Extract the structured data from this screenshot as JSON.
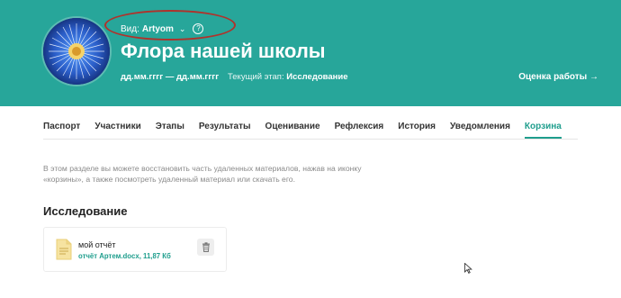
{
  "header": {
    "view_label": "Вид:",
    "view_value": "Artyom",
    "view_chevron": "⌄",
    "help_glyph": "?",
    "project_title": "Флора нашей школы",
    "dates": "дд.мм.гггг — дд.мм.гггг",
    "stage_label": "Текущий этап:",
    "stage_value": "Исследование",
    "assess_link": "Оценка работы →",
    "avatar_icon": "dandelion-avatar"
  },
  "tabs": [
    {
      "label": "Паспорт"
    },
    {
      "label": "Участники"
    },
    {
      "label": "Этапы"
    },
    {
      "label": "Результаты"
    },
    {
      "label": "Оценивание"
    },
    {
      "label": "Рефлексия"
    },
    {
      "label": "История"
    },
    {
      "label": "Уведомления"
    },
    {
      "label": "Корзина",
      "active": true
    }
  ],
  "info_text": "В этом разделе вы можете восстановить часть удаленных материалов, нажав на иконку «корзины», а также посмотреть удаленный материал или скачать его.",
  "section_title": "Исследование",
  "file": {
    "name": "мой отчёт",
    "meta": "отчёт Артем.docx, 11,87 Кб",
    "icon": "document-icon",
    "action_icon": "trash-restore-icon"
  },
  "colors": {
    "header_bg": "#27a69a",
    "accent": "#1f9e8d",
    "annotation": "#b0322b"
  }
}
